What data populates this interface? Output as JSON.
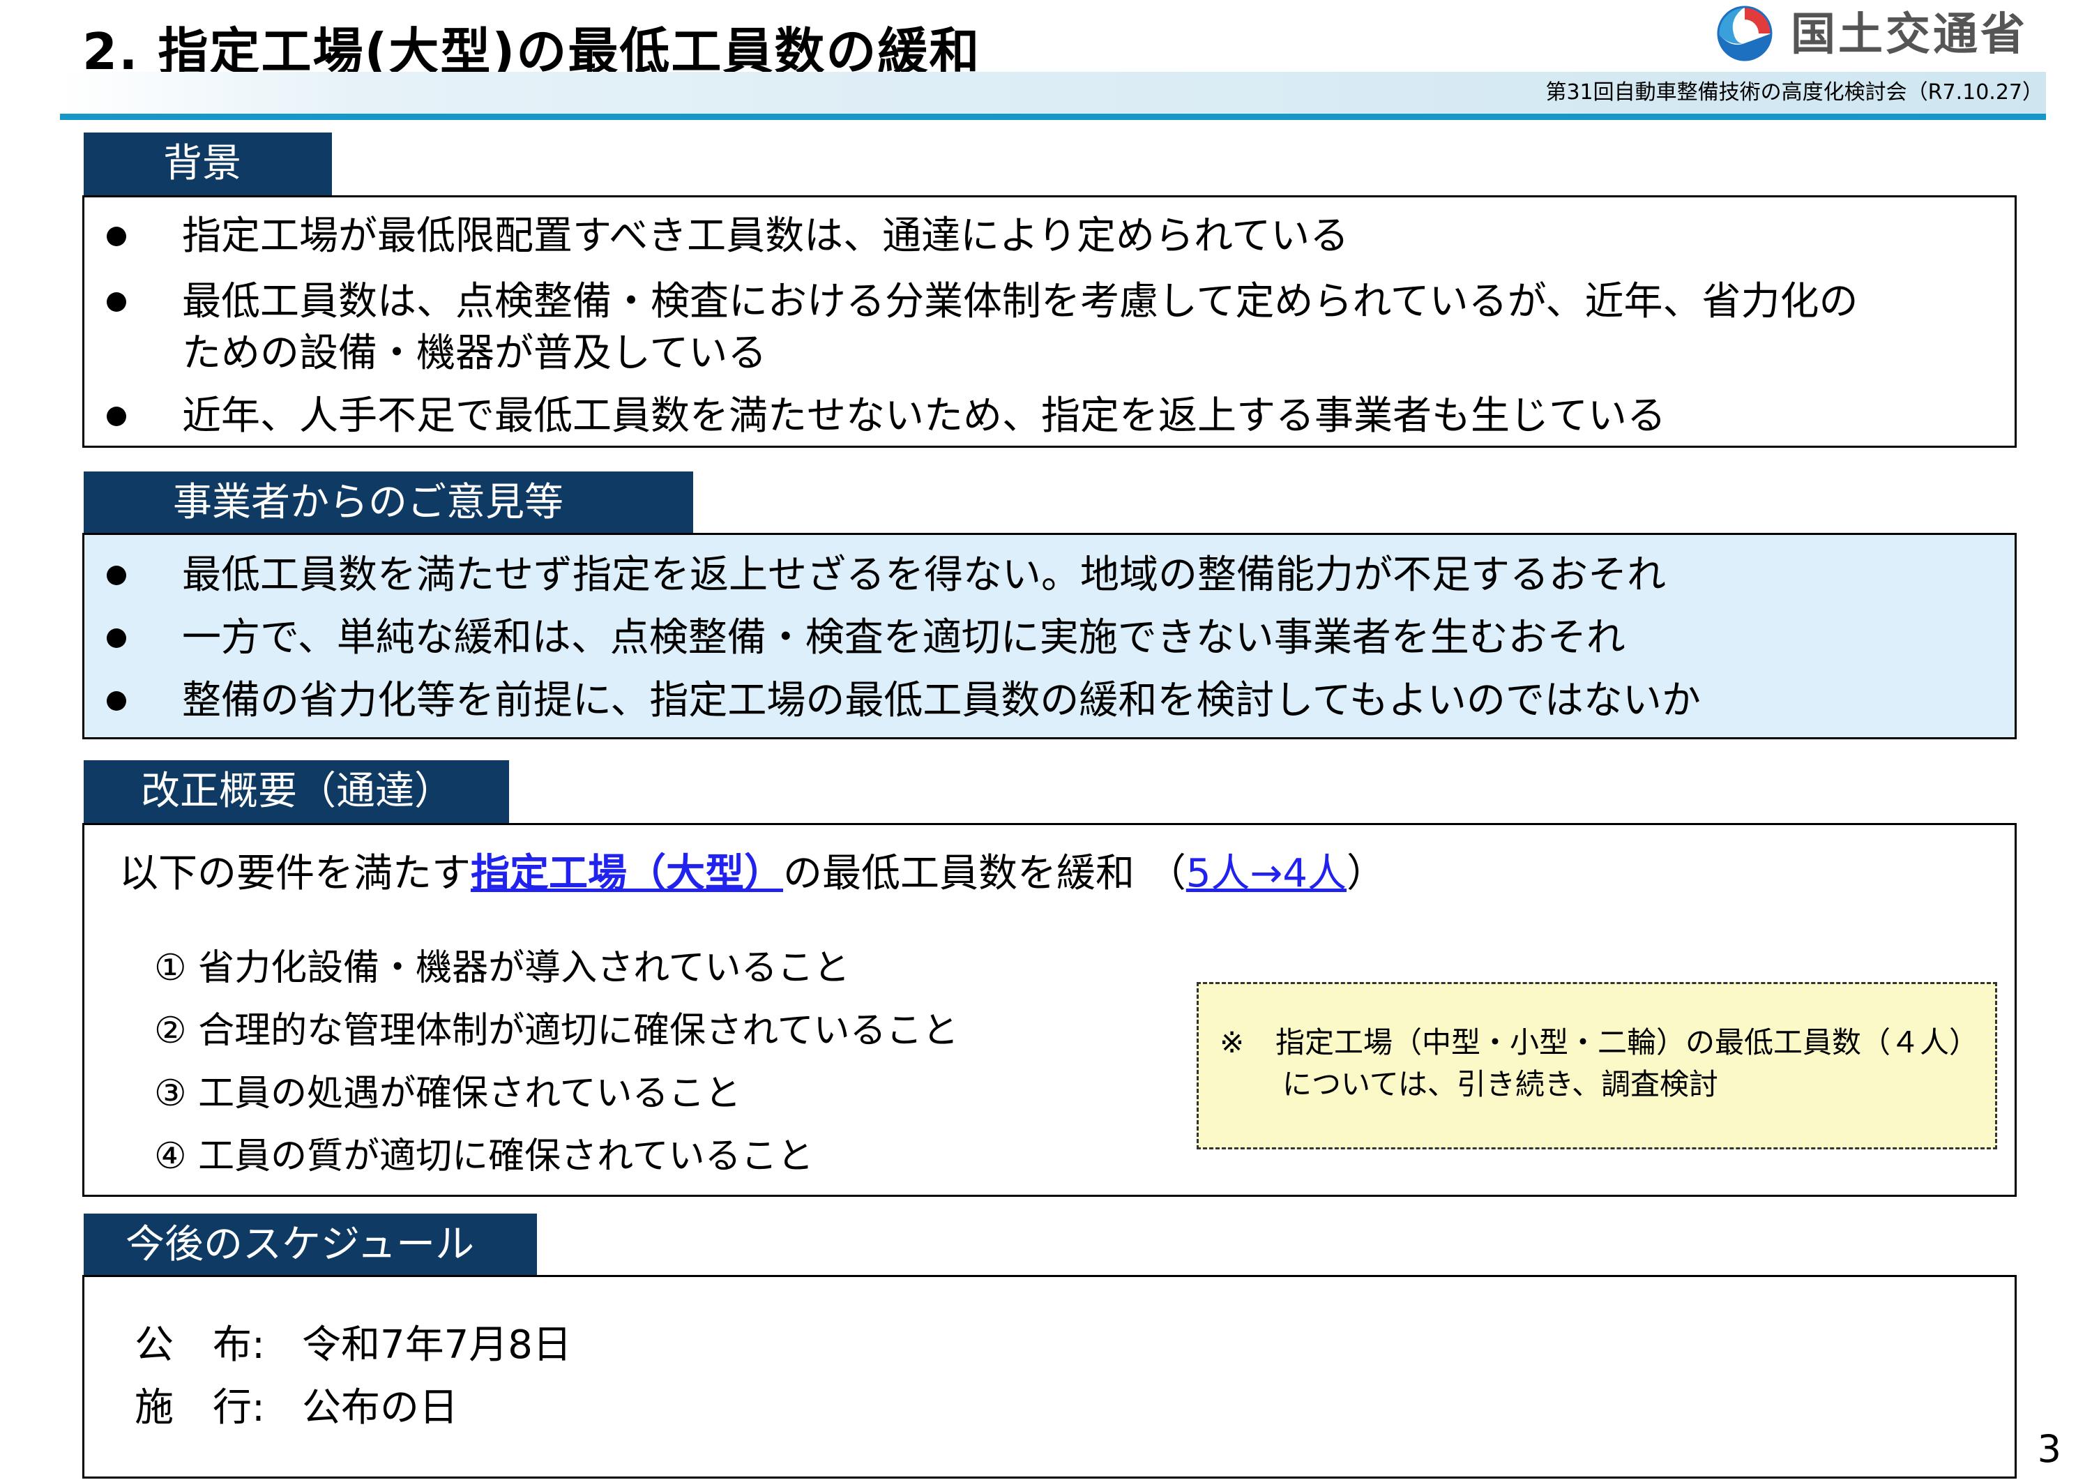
{
  "header": {
    "title": "2. 指定工場(大型)の最低工員数の緩和",
    "meeting": "第31回自動車整備技術の高度化検討会（R7.10.27）",
    "logo_text": "国土交通省",
    "logo_icon": "mlit-logo-icon"
  },
  "background": {
    "heading": "背景",
    "items": [
      "指定工場が最低限配置すべき工員数は、通達により定められている",
      "最低工員数は、点検整備・検査における分業体制を考慮して定められているが、近年、省力化の",
      "ための設備・機器が普及している",
      "近年、人手不足で最低工員数を満たせないため、指定を返上する事業者も生じている"
    ]
  },
  "opinions": {
    "heading": "事業者からのご意見等",
    "items": [
      "最低工員数を満たせず指定を返上せざるを得ない。地域の整備能力が不足するおそれ",
      "一方で、単純な緩和は、点検整備・検査を適切に実施できない事業者を生むおそれ",
      "整備の省力化等を前提に、指定工場の最低工員数の緩和を検討してもよいのではないか"
    ]
  },
  "revision": {
    "heading": "改正概要（通達）",
    "lead_prefix": "以下の要件を満たす",
    "lead_link": "指定工場（大型）",
    "lead_middle": "の最低工員数を緩和 （",
    "lead_change": "5人→4人",
    "lead_suffix": "）",
    "requirements": [
      "① 省力化設備・機器が導入されていること",
      "② 合理的な管理体制が適切に確保されていること",
      "③ 工員の処遇が確保されていること",
      "④ 工員の質が適切に確保されていること"
    ],
    "note_mark": "※",
    "note_line1": "指定工場（中型・小型・二輪）の最低工員数（４人）",
    "note_line2": "については、引き続き、調査検討"
  },
  "schedule": {
    "heading": "今後のスケジュール",
    "promulgation_label": "公　布:",
    "promulgation_value": "令和7年7月8日",
    "enforcement_label": "施　行:",
    "enforcement_value": "公布の日"
  },
  "page_number": "3",
  "colors": {
    "tab_bg": "#0f3a63",
    "header_line": "#1796c8",
    "opinions_bg": "#dceffa",
    "note_bg": "#fbf9c8",
    "link_blue": "#2222ee"
  }
}
